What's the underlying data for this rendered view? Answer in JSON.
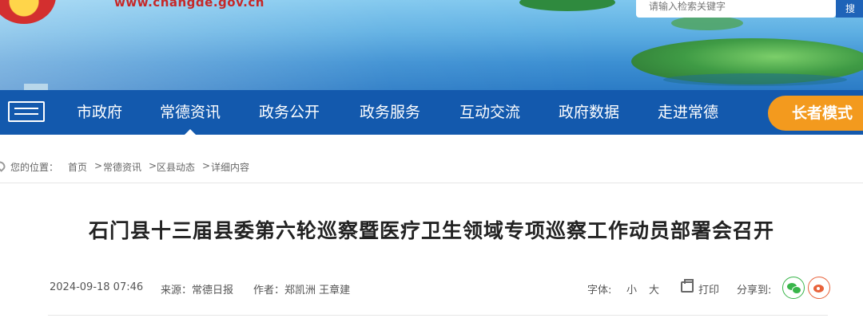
{
  "header": {
    "site_url": "www.changde.gov.cn",
    "search": {
      "placeholder": "请输入检索关键字",
      "button_label": "搜"
    }
  },
  "nav": {
    "items": [
      {
        "label": "市政府"
      },
      {
        "label": "常德资讯",
        "active": true
      },
      {
        "label": "政务公开"
      },
      {
        "label": "政务服务"
      },
      {
        "label": "互动交流"
      },
      {
        "label": "政府数据"
      },
      {
        "label": "走进常德"
      }
    ],
    "elder_mode_label": "长者模式"
  },
  "breadcrumb": {
    "prefix": "您的位置：",
    "items": [
      "首页",
      "常德资讯",
      "区县动态",
      "详细内容"
    ],
    "separator": ">"
  },
  "article": {
    "title": "石门县十三届县委第六轮巡察暨医疗卫生领域专项巡察工作动员部署会召开",
    "date": "2024-09-18 07:46",
    "source": "来源：常德日报",
    "author": "作者：郑凯洲 王章建",
    "font_label": "字体:",
    "font_small": "小",
    "font_large": "大",
    "print_label": "打印",
    "share_label": "分享到:"
  },
  "colors": {
    "nav_bg": "#1359ad",
    "elder_button": "#f39a1e",
    "wechat": "#39b54a",
    "weibo": "#e8623a"
  }
}
